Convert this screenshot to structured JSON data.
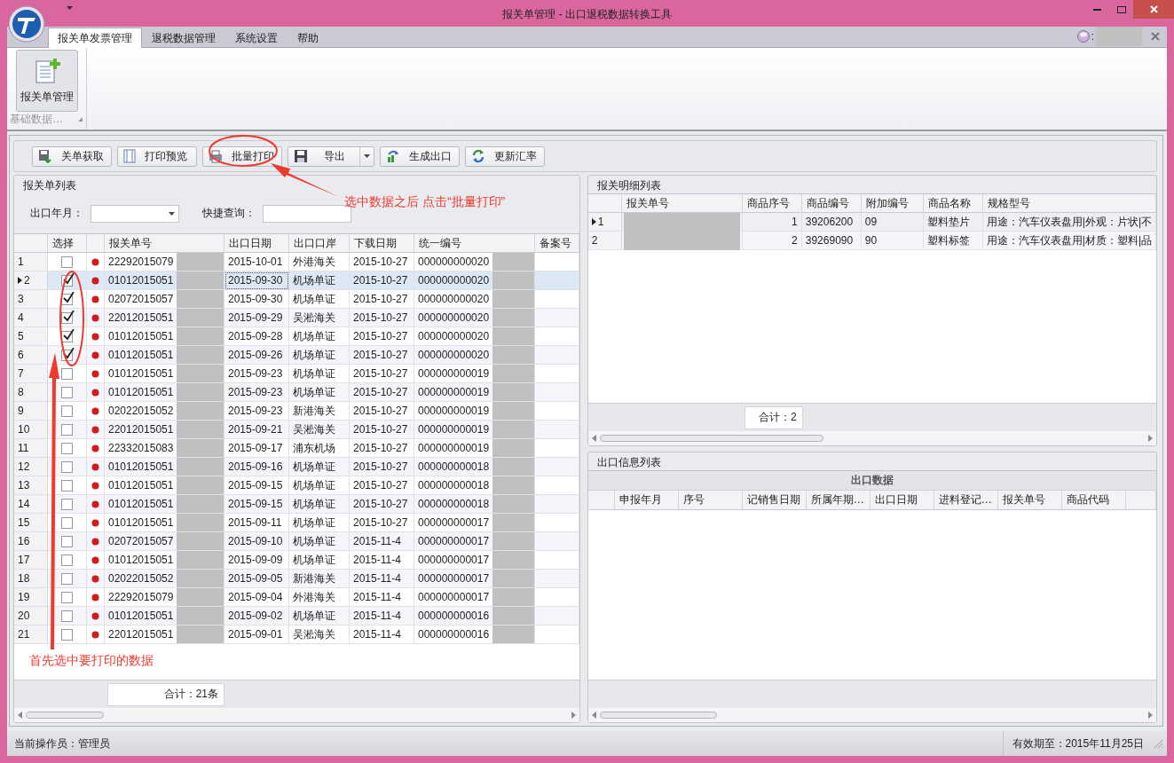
{
  "window": {
    "title": "报关单管理 - 出口退税数据转换工具"
  },
  "ribbon": {
    "tabs": [
      {
        "label": "报关单发票管理",
        "selected": true
      },
      {
        "label": "退税数据管理",
        "selected": false
      },
      {
        "label": "系统设置",
        "selected": false
      },
      {
        "label": "帮助",
        "selected": false
      }
    ],
    "user_label": ":",
    "buttons": [
      {
        "label": "报关单管理",
        "selected": true
      }
    ],
    "group_label": "基础数据…"
  },
  "toolbar": [
    {
      "label": "关单获取",
      "kind": "button"
    },
    {
      "label": "打印预览",
      "kind": "button"
    },
    {
      "label": "批量打印",
      "kind": "button"
    },
    {
      "label": "导出",
      "kind": "split"
    },
    {
      "label": "生成出口",
      "kind": "button"
    },
    {
      "label": "更新汇率",
      "kind": "button"
    }
  ],
  "list_panel": {
    "title": "报关单列表",
    "filters": [
      {
        "label": "出口年月：",
        "kind": "combo"
      },
      {
        "label": "快捷查询：",
        "kind": "text"
      }
    ],
    "columns": [
      "选择",
      "报关单号",
      "出口日期",
      "出口口岸",
      "下载日期",
      "统一编号",
      "备案号"
    ],
    "rows": [
      {
        "no": "1",
        "selected": false,
        "checked": false,
        "number": "22292015079",
        "export_date": "2015-10-01",
        "port": "外港海关",
        "download_date": "2015-10-27",
        "uniform_no": "000000000020"
      },
      {
        "no": "2",
        "selected": true,
        "checked": true,
        "number": "01012015051",
        "export_date": "2015-09-30",
        "port": "机场单证",
        "download_date": "2015-10-27",
        "uniform_no": "000000000020"
      },
      {
        "no": "3",
        "selected": false,
        "checked": true,
        "number": "02072015057",
        "export_date": "2015-09-30",
        "port": "机场单证",
        "download_date": "2015-10-27",
        "uniform_no": "000000000020"
      },
      {
        "no": "4",
        "selected": false,
        "checked": true,
        "number": "22012015051",
        "export_date": "2015-09-29",
        "port": "吴淞海关",
        "download_date": "2015-10-27",
        "uniform_no": "000000000020"
      },
      {
        "no": "5",
        "selected": false,
        "checked": true,
        "number": "01012015051",
        "export_date": "2015-09-28",
        "port": "机场单证",
        "download_date": "2015-10-27",
        "uniform_no": "000000000020"
      },
      {
        "no": "6",
        "selected": false,
        "checked": true,
        "number": "01012015051",
        "export_date": "2015-09-26",
        "port": "机场单证",
        "download_date": "2015-10-27",
        "uniform_no": "000000000020"
      },
      {
        "no": "7",
        "selected": false,
        "checked": false,
        "number": "01012015051",
        "export_date": "2015-09-23",
        "port": "机场单证",
        "download_date": "2015-10-27",
        "uniform_no": "000000000019"
      },
      {
        "no": "8",
        "selected": false,
        "checked": false,
        "number": "01012015051",
        "export_date": "2015-09-23",
        "port": "机场单证",
        "download_date": "2015-10-27",
        "uniform_no": "000000000019"
      },
      {
        "no": "9",
        "selected": false,
        "checked": false,
        "number": "02022015052",
        "export_date": "2015-09-23",
        "port": "新港海关",
        "download_date": "2015-10-27",
        "uniform_no": "000000000019"
      },
      {
        "no": "10",
        "selected": false,
        "checked": false,
        "number": "22012015051",
        "export_date": "2015-09-21",
        "port": "吴淞海关",
        "download_date": "2015-10-27",
        "uniform_no": "000000000019"
      },
      {
        "no": "11",
        "selected": false,
        "checked": false,
        "number": "22332015083",
        "export_date": "2015-09-17",
        "port": "浦东机场",
        "download_date": "2015-10-27",
        "uniform_no": "000000000019"
      },
      {
        "no": "12",
        "selected": false,
        "checked": false,
        "number": "01012015051",
        "export_date": "2015-09-16",
        "port": "机场单证",
        "download_date": "2015-10-27",
        "uniform_no": "000000000018"
      },
      {
        "no": "13",
        "selected": false,
        "checked": false,
        "number": "01012015051",
        "export_date": "2015-09-15",
        "port": "机场单证",
        "download_date": "2015-10-27",
        "uniform_no": "000000000018"
      },
      {
        "no": "14",
        "selected": false,
        "checked": false,
        "number": "01012015051",
        "export_date": "2015-09-15",
        "port": "机场单证",
        "download_date": "2015-10-27",
        "uniform_no": "000000000018"
      },
      {
        "no": "15",
        "selected": false,
        "checked": false,
        "number": "01012015051",
        "export_date": "2015-09-11",
        "port": "机场单证",
        "download_date": "2015-10-27",
        "uniform_no": "000000000017"
      },
      {
        "no": "16",
        "selected": false,
        "checked": false,
        "number": "02072015057",
        "export_date": "2015-09-10",
        "port": "机场单证",
        "download_date": "2015-11-4",
        "uniform_no": "000000000017"
      },
      {
        "no": "17",
        "selected": false,
        "checked": false,
        "number": "01012015051",
        "export_date": "2015-09-09",
        "port": "机场单证",
        "download_date": "2015-11-4",
        "uniform_no": "000000000017"
      },
      {
        "no": "18",
        "selected": false,
        "checked": false,
        "number": "02022015052",
        "export_date": "2015-09-05",
        "port": "新港海关",
        "download_date": "2015-11-4",
        "uniform_no": "000000000017"
      },
      {
        "no": "19",
        "selected": false,
        "checked": false,
        "number": "22292015079",
        "export_date": "2015-09-04",
        "port": "外港海关",
        "download_date": "2015-11-4",
        "uniform_no": "000000000017"
      },
      {
        "no": "20",
        "selected": false,
        "checked": false,
        "number": "01012015051",
        "export_date": "2015-09-02",
        "port": "机场单证",
        "download_date": "2015-11-4",
        "uniform_no": "000000000016"
      },
      {
        "no": "21",
        "selected": false,
        "checked": false,
        "number": "22012015051",
        "export_date": "2015-09-01",
        "port": "吴淞海关",
        "download_date": "2015-11-4",
        "uniform_no": "000000000016"
      }
    ],
    "total": "合计：21条"
  },
  "detail_panel": {
    "title": "报关明细列表",
    "columns": [
      "报关单号",
      "商品序号",
      "商品编号",
      "附加编号",
      "商品名称",
      "规格型号"
    ],
    "rows": [
      {
        "no": "1",
        "selected": true,
        "seq": "1",
        "code": "39206200",
        "extra": "09",
        "name": "塑料垫片",
        "spec": "用途：汽车仪表盘用|外观：片状|不"
      },
      {
        "no": "2",
        "selected": false,
        "seq": "2",
        "code": "39269090",
        "extra": "90",
        "name": "塑料标签",
        "spec": "用途：汽车仪表盘用|材质：塑料|品"
      }
    ],
    "total": "合计：2"
  },
  "export_panel": {
    "title": "出口信息列表",
    "band": "出口数据",
    "columns": [
      "申报年月",
      "序号",
      "记销售日期",
      "所属年期…",
      "出口日期",
      "进料登记…",
      "报关单号",
      "商品代码"
    ]
  },
  "status_bar": {
    "operator": "当前操作员：管理员",
    "expiry": "有效期至：2015年11月25日"
  },
  "annotations": [
    {
      "text": "选中数据之后 点击“批量打印”"
    },
    {
      "text": "首先选中要打印的数据"
    }
  ]
}
